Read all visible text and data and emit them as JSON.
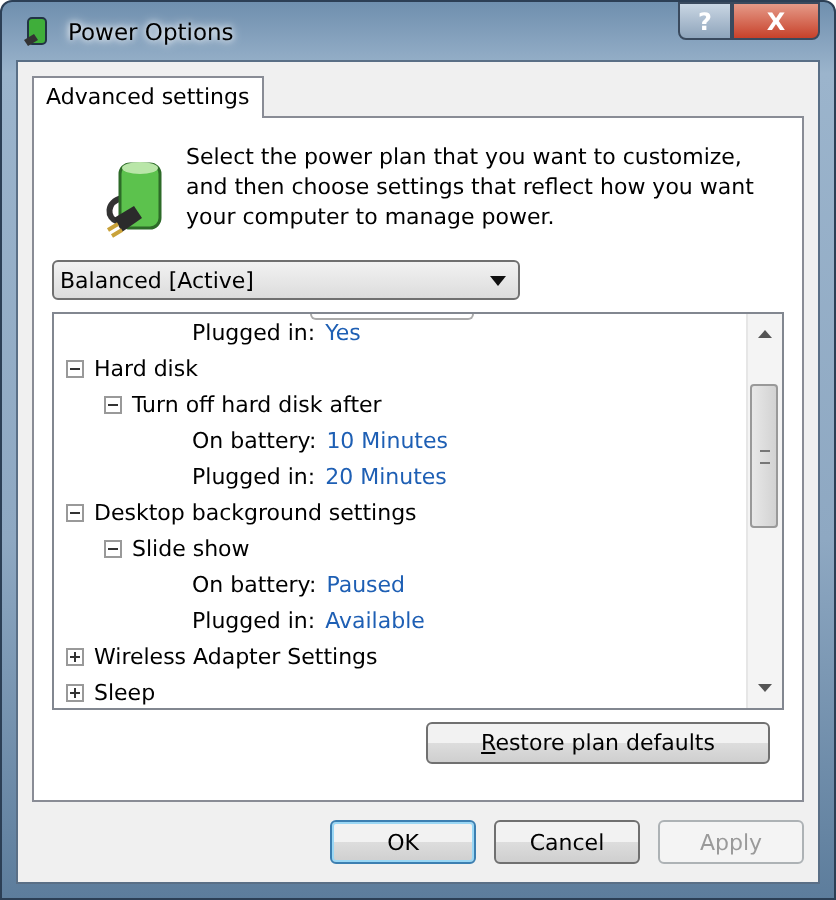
{
  "window": {
    "title": "Power Options"
  },
  "title_buttons": [
    {
      "kind": "help",
      "label": "?"
    },
    {
      "kind": "close",
      "label": "X"
    }
  ],
  "tabs": [
    {
      "label": "Advanced settings",
      "selected": true
    }
  ],
  "intro": "Select the power plan that you want to customize, and then choose settings that reflect how you want your computer to manage power.",
  "plan_dropdown": {
    "value": "Balanced [Active]"
  },
  "tree": [
    {
      "kind": "setting",
      "label": "Plugged in:",
      "value": "Yes"
    },
    {
      "kind": "group",
      "label": "Hard disk",
      "expanded": true,
      "children": [
        {
          "kind": "group",
          "label": "Turn off hard disk after",
          "expanded": true,
          "children": [
            {
              "kind": "setting",
              "label": "On battery:",
              "value": "10 Minutes"
            },
            {
              "kind": "setting",
              "label": "Plugged in:",
              "value": "20 Minutes"
            }
          ]
        }
      ]
    },
    {
      "kind": "group",
      "label": "Desktop background settings",
      "expanded": true,
      "children": [
        {
          "kind": "group",
          "label": "Slide show",
          "expanded": true,
          "children": [
            {
              "kind": "setting",
              "label": "On battery:",
              "value": "Paused"
            },
            {
              "kind": "setting",
              "label": "Plugged in:",
              "value": "Available"
            }
          ]
        }
      ]
    },
    {
      "kind": "group",
      "label": "Wireless Adapter Settings",
      "expanded": false
    },
    {
      "kind": "group",
      "label": "Sleep",
      "expanded": false
    }
  ],
  "restore_button": {
    "label": "**R**estore plan defaults"
  },
  "buttons": [
    {
      "label": "OK",
      "disabled": false,
      "default": true
    },
    {
      "label": "Cancel",
      "disabled": false,
      "default": false
    },
    {
      "label": "Apply",
      "disabled": true,
      "default": false
    }
  ]
}
